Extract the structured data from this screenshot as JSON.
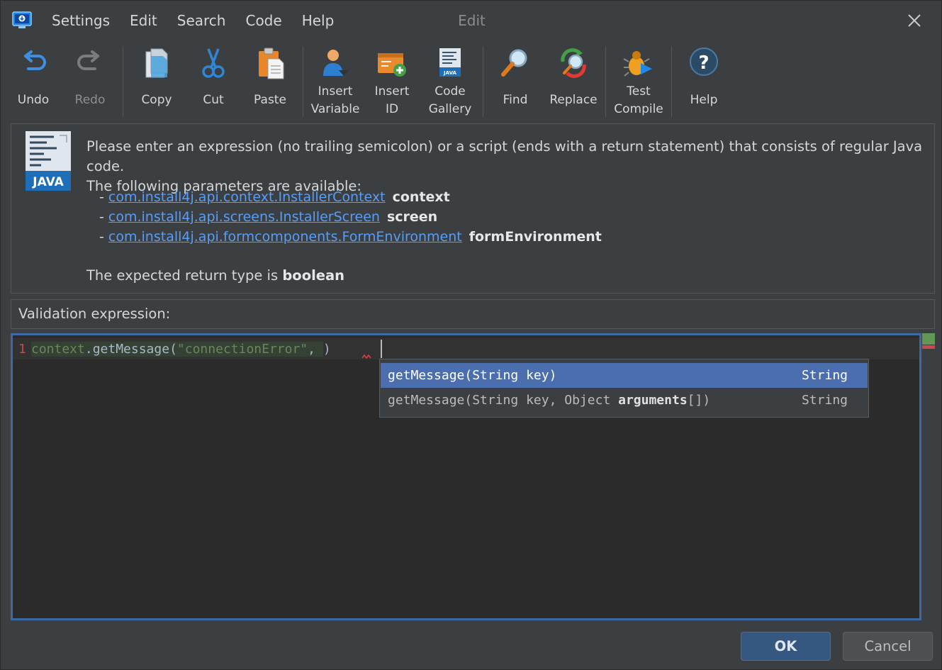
{
  "menu": {
    "items": [
      "Settings",
      "Edit",
      "Search",
      "Code",
      "Help"
    ],
    "window_title": "Edit"
  },
  "toolbar": {
    "undo": "Undo",
    "redo": "Redo",
    "copy": "Copy",
    "cut": "Cut",
    "paste": "Paste",
    "insert_variable": [
      "Insert",
      "Variable"
    ],
    "insert_id": [
      "Insert",
      "ID"
    ],
    "code_gallery": [
      "Code",
      "Gallery"
    ],
    "find": "Find",
    "replace": "Replace",
    "test_compile": [
      "Test",
      "Compile"
    ],
    "help": "Help"
  },
  "info": {
    "logo_text": "JAVA",
    "line1": "Please enter an expression (no trailing semicolon) or a script (ends with a return statement) that consists of regular Java code.",
    "line2": "The following parameters are available:",
    "params": [
      {
        "type": "com.install4j.api.context.InstallerContext",
        "name": "context"
      },
      {
        "type": "com.install4j.api.screens.InstallerScreen",
        "name": "screen"
      },
      {
        "type": "com.install4j.api.formcomponents.FormEnvironment",
        "name": "formEnvironment"
      }
    ],
    "return_prefix": "The expected return type is ",
    "return_type": "boolean"
  },
  "validation_label": "Validation expression:",
  "editor": {
    "line_number": "1",
    "code_context": "context",
    "code_method": ".getMessage(",
    "code_string": "\"connectionError\"",
    "code_comma": ", ",
    "code_paren": ")"
  },
  "completion": [
    {
      "name": "getMessage",
      "params": "(String key)",
      "bold": "",
      "tail": "",
      "type": "String"
    },
    {
      "name": "getMessage",
      "params": "(String key, Object ",
      "bold": "arguments",
      "tail": "[])",
      "type": "String"
    }
  ],
  "buttons": {
    "ok": "OK",
    "cancel": "Cancel"
  },
  "colors": {
    "background": "#3c3f41",
    "editor_bg": "#2b2b2b",
    "link": "#589df6",
    "selection": "#4b6eaf",
    "focus_border": "#3d6aa6"
  }
}
